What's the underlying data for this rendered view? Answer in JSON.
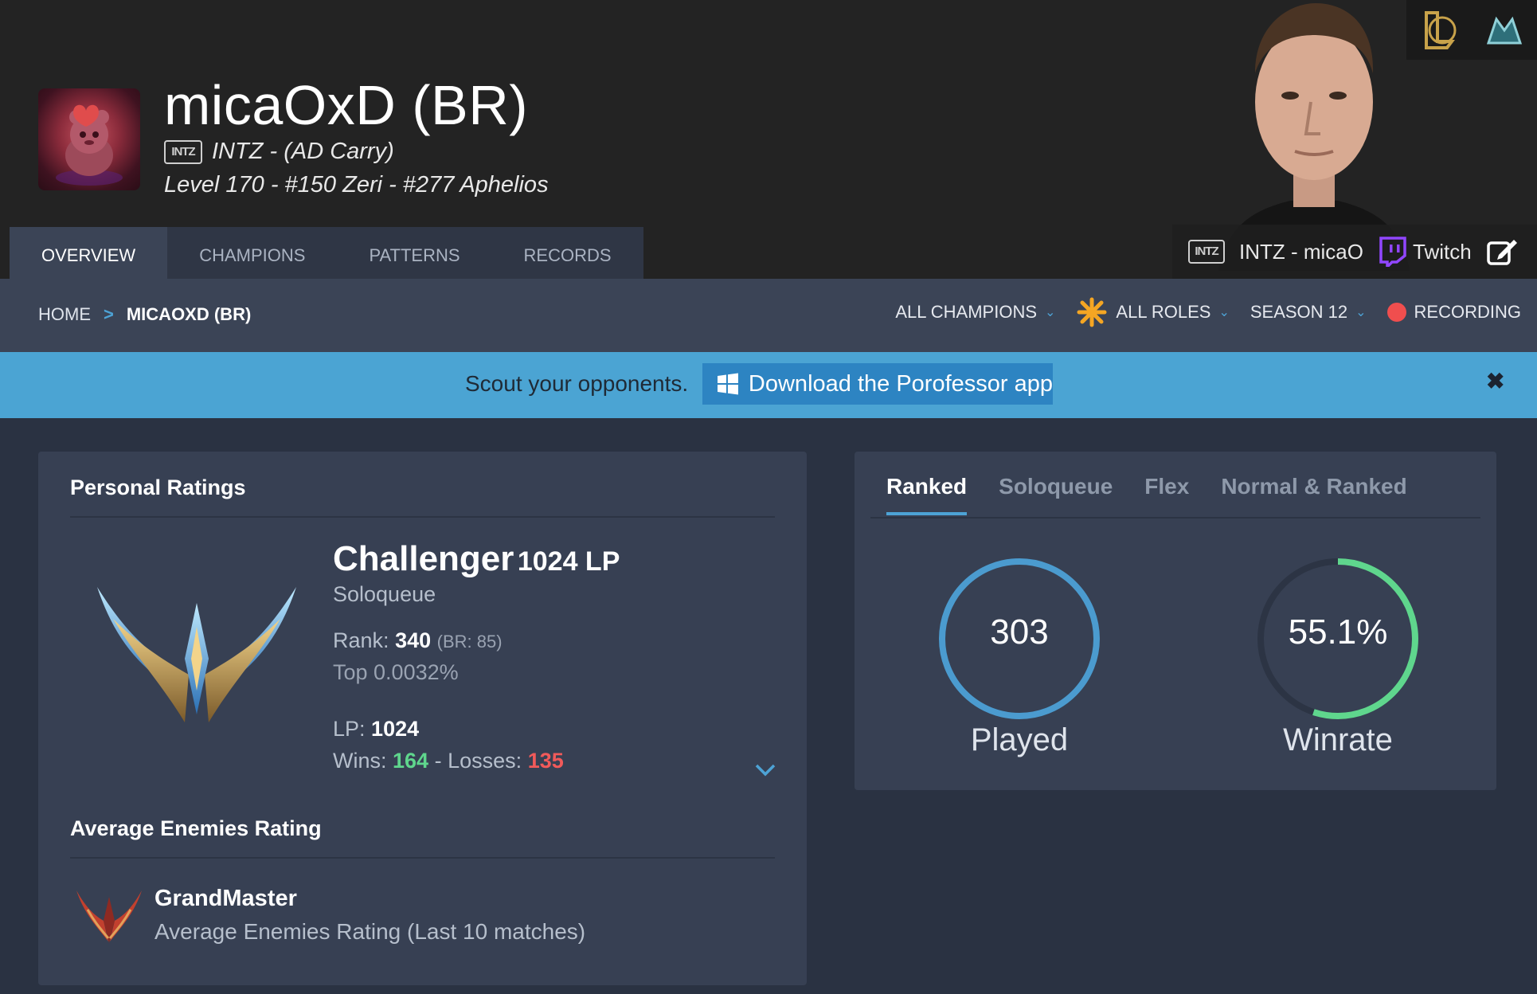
{
  "header": {
    "summoner_name": "micaOxD (BR)",
    "team_logo_text": "INTZ",
    "team_line": "INTZ - (AD Carry)",
    "level_line": "Level 170 - #150 Zeri - #277 Aphelios"
  },
  "tabs": [
    {
      "label": "OVERVIEW",
      "active": true
    },
    {
      "label": "CHAMPIONS",
      "active": false
    },
    {
      "label": "PATTERNS",
      "active": false
    },
    {
      "label": "RECORDS",
      "active": false
    }
  ],
  "pro_bar": {
    "team_logo_text": "INTZ",
    "pro_name": "INTZ - micaO",
    "twitch_label": "Twitch"
  },
  "breadcrumb": {
    "home": "HOME",
    "separator": ">",
    "current": "MICAOXD (BR)"
  },
  "filters": {
    "champions": "ALL CHAMPIONS",
    "roles": "ALL ROLES",
    "season": "SEASON 12",
    "recording": "RECORDING"
  },
  "banner": {
    "text": "Scout your opponents.",
    "button_label": "Download the Porofessor app",
    "close": "✖"
  },
  "personal_ratings": {
    "title": "Personal Ratings",
    "tier": "Challenger",
    "tier_lp": "1024 LP",
    "queue": "Soloqueue",
    "rank_label": "Rank:",
    "rank_value": "340",
    "rank_br": "(BR: 85)",
    "top": "Top 0.0032%",
    "lp_label": "LP:",
    "lp_value": "1024",
    "wins_label": "Wins:",
    "wins_value": "164",
    "wl_sep": "-",
    "losses_label": "Losses:",
    "losses_value": "135"
  },
  "average_enemies": {
    "title": "Average Enemies Rating",
    "tier": "GrandMaster",
    "subtitle": "Average Enemies Rating (Last 10 matches)"
  },
  "stats": {
    "tabs": [
      {
        "label": "Ranked",
        "active": true
      },
      {
        "label": "Soloqueue",
        "active": false
      },
      {
        "label": "Flex",
        "active": false
      },
      {
        "label": "Normal & Ranked",
        "active": false
      }
    ],
    "played_value": "303",
    "played_label": "Played",
    "winrate_value": "55.1%",
    "winrate_label": "Winrate",
    "winrate_fraction": 0.551
  },
  "colors": {
    "accent": "#4da3d6",
    "win": "#5fd68d",
    "loss": "#f15a5a",
    "twitch": "#9146ff"
  }
}
